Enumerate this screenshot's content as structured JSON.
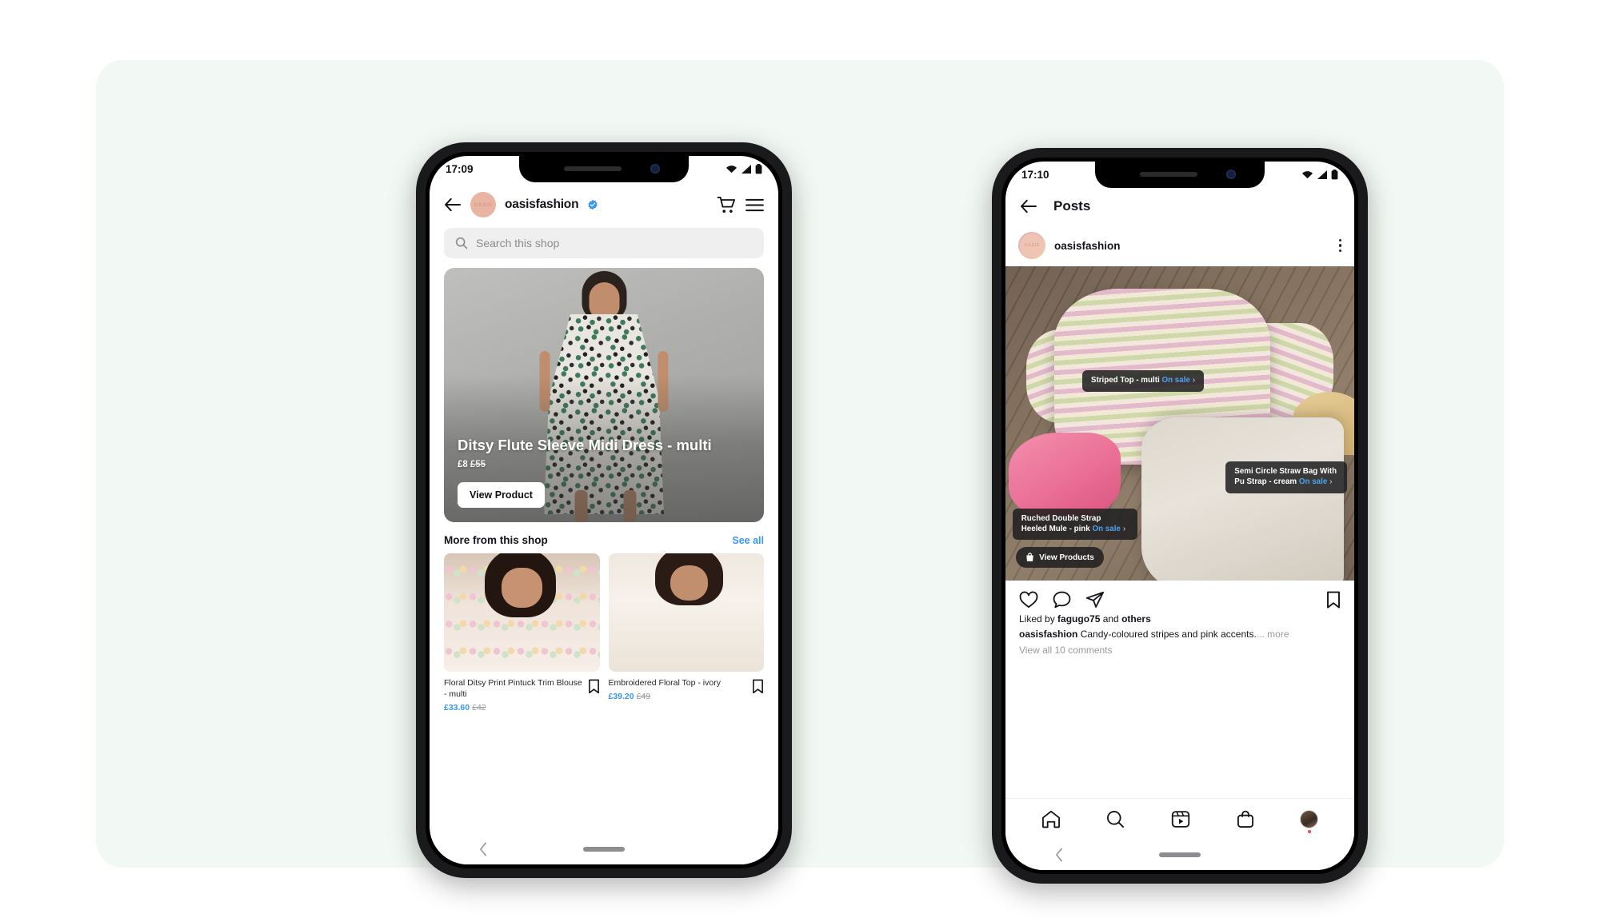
{
  "background": {
    "panel_color": "#f2f8f3",
    "page_color": "#ffffff"
  },
  "accent": {
    "link_blue": "#3897f0",
    "sale_blue": "#4aa3f0",
    "verified_blue": "#3897f0"
  },
  "phone_left": {
    "status_bar": {
      "time": "17:09",
      "wifi_icon": "wifi-icon",
      "signal_icon": "signal-bars-icon",
      "battery_icon": "battery-icon"
    },
    "header": {
      "back_icon": "back-arrow-icon",
      "avatar_label": "OASIS",
      "shop_name": "oasisfashion",
      "verified_icon": "verified-badge-icon",
      "cart_icon": "shopping-cart-icon",
      "menu_icon": "hamburger-menu-icon"
    },
    "search": {
      "icon": "search-icon",
      "placeholder": "Search this shop",
      "value": ""
    },
    "hero": {
      "title": "Ditsy Flute Sleeve Midi Dress - multi",
      "price": "£8",
      "price_was": "£55",
      "cta_label": "View Product"
    },
    "more_section": {
      "title": "More from this shop",
      "see_all_label": "See all",
      "products": [
        {
          "name": "Floral Ditsy Print Pintuck Trim Blouse - multi",
          "price": "£33.60",
          "price_was": "£42",
          "save_icon": "bookmark-icon"
        },
        {
          "name": "Embroidered Floral Top - ivory",
          "price": "£39.20",
          "price_was": "£49",
          "save_icon": "bookmark-icon"
        }
      ]
    },
    "system_nav": {
      "back_icon": "system-back-chevron-icon",
      "home_pill": "home-indicator-pill"
    }
  },
  "phone_right": {
    "status_bar": {
      "time": "17:10",
      "wifi_icon": "wifi-icon",
      "signal_icon": "signal-bars-icon",
      "battery_icon": "battery-icon"
    },
    "header": {
      "back_icon": "back-arrow-icon",
      "title": "Posts"
    },
    "post": {
      "avatar_label": "OASIS",
      "username": "oasisfashion",
      "options_icon": "more-options-icon",
      "product_tags": [
        {
          "name": "Striped Top - multi",
          "sale_label": "On sale",
          "chevron": "›"
        },
        {
          "name": "Semi Circle Straw Bag With Pu Strap - cream",
          "sale_label": "On sale",
          "chevron": "›"
        },
        {
          "name": "Ruched Double Strap Heeled Mule - pink",
          "sale_label": "On sale",
          "chevron": "›"
        }
      ],
      "view_products_label": "View Products",
      "view_products_icon": "shopping-bag-icon",
      "actions": {
        "like_icon": "heart-icon",
        "comment_icon": "comment-bubble-icon",
        "share_icon": "share-paper-plane-icon",
        "save_icon": "bookmark-icon"
      },
      "liked_by_prefix": "Liked by ",
      "liked_by_user": "fagugo75",
      "liked_by_mid": " and ",
      "liked_by_others": "others",
      "caption_user": "oasisfashion",
      "caption_text": " Candy-coloured stripes and pink accents.",
      "caption_ellipsis": "...",
      "caption_more": "more",
      "comments_label": "View all 10 comments"
    },
    "tab_bar": {
      "home_icon": "home-icon",
      "search_icon": "search-icon",
      "reels_icon": "reels-icon",
      "shop_icon": "shop-bag-icon",
      "profile_icon": "profile-avatar-icon"
    },
    "system_nav": {
      "back_icon": "system-back-chevron-icon",
      "home_pill": "home-indicator-pill"
    }
  }
}
